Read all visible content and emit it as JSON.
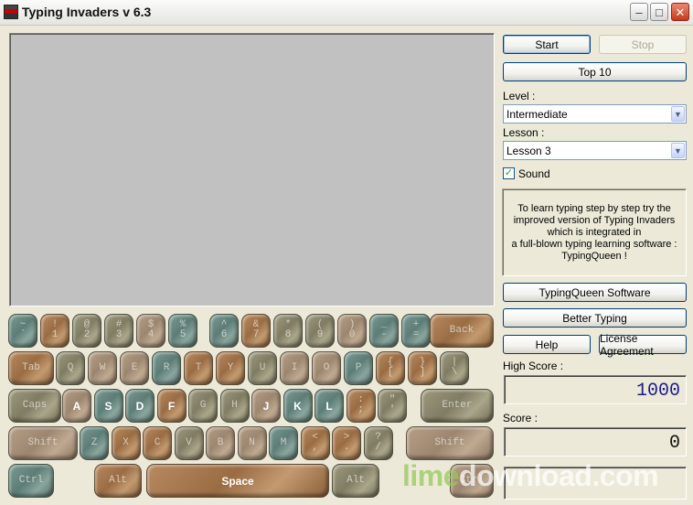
{
  "window": {
    "title": "Typing Invaders v 6.3",
    "controls": {
      "minimize": "–",
      "maximize": "□",
      "close": "✕"
    }
  },
  "controls": {
    "start": "Start",
    "stop": "Stop",
    "top10": "Top 10",
    "level_label": "Level :",
    "level_value": "Intermediate",
    "lesson_label": "Lesson :",
    "lesson_value": "Lesson 3",
    "sound_label": "Sound",
    "sound_checked": true,
    "info_text": "To learn typing step by step try the\nimproved version of Typing Invaders\nwhich is integrated in\na full-blown typing learning software :\nTypingQueen !",
    "typingqueen": "TypingQueen Software",
    "better_typing": "Better Typing",
    "help": "Help",
    "license": "License Agreement",
    "high_score_label": "High Score :",
    "high_score": "1000",
    "score_label": "Score :",
    "score": "0"
  },
  "keyboard": {
    "row1": [
      "~\n`",
      "!\n1",
      "@\n2",
      "#\n3",
      "$\n4",
      "%\n5",
      "^\n6",
      "&\n7",
      "*\n8",
      "(\n9",
      ")\n0",
      "_\n-",
      "+\n=",
      "Back"
    ],
    "row2": [
      "Tab",
      "Q",
      "W",
      "E",
      "R",
      "T",
      "Y",
      "U",
      "I",
      "O",
      "P",
      "{\n[",
      "}\n]",
      "|\n\\"
    ],
    "row3": [
      "Caps",
      "A",
      "S",
      "D",
      "F",
      "G",
      "H",
      "J",
      "K",
      "L",
      ":\n;",
      "\"\n'",
      "Enter"
    ],
    "row4": [
      "Shift",
      "Z",
      "X",
      "C",
      "V",
      "B",
      "N",
      "M",
      "<\n,",
      ">\n.",
      "?\n/",
      "Shift"
    ],
    "row5": [
      "Ctrl",
      "Alt",
      "Space",
      "Alt",
      "Ctrl"
    ]
  },
  "watermark": {
    "prefix": "lime",
    "middle": "d",
    "suffix": "ownload.com"
  }
}
